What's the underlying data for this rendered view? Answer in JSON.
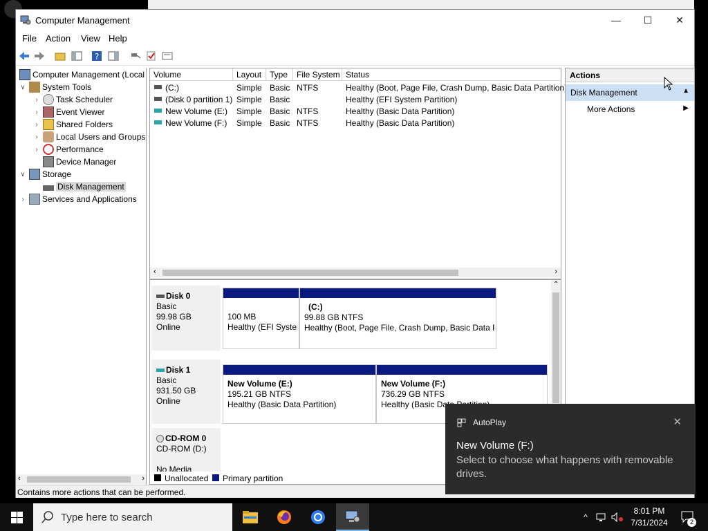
{
  "window": {
    "title": "Computer Management",
    "controls": {
      "minimize": "—",
      "maximize": "☐",
      "close": "✕"
    }
  },
  "menu": [
    "File",
    "Action",
    "View",
    "Help"
  ],
  "tree": {
    "root": "Computer Management (Local",
    "system_tools": "System Tools",
    "items": [
      "Task Scheduler",
      "Event Viewer",
      "Shared Folders",
      "Local Users and Groups",
      "Performance",
      "Device Manager"
    ],
    "storage": "Storage",
    "disk_management": "Disk Management",
    "services": "Services and Applications"
  },
  "volume_list": {
    "columns": [
      "Volume",
      "Layout",
      "Type",
      "File System",
      "Status"
    ],
    "rows": [
      {
        "volume": "(C:)",
        "layout": "Simple",
        "type": "Basic",
        "fs": "NTFS",
        "status": "Healthy (Boot, Page File, Crash Dump, Basic Data Partition)"
      },
      {
        "volume": "(Disk 0 partition 1)",
        "layout": "Simple",
        "type": "Basic",
        "fs": "",
        "status": "Healthy (EFI System Partition)"
      },
      {
        "volume": "New Volume (E:)",
        "layout": "Simple",
        "type": "Basic",
        "fs": "NTFS",
        "status": "Healthy (Basic Data Partition)"
      },
      {
        "volume": "New Volume (F:)",
        "layout": "Simple",
        "type": "Basic",
        "fs": "NTFS",
        "status": "Healthy (Basic Data Partition)"
      }
    ]
  },
  "disks": {
    "disk0": {
      "name": "Disk 0",
      "type": "Basic",
      "size": "99.98 GB",
      "state": "Online",
      "p1": {
        "size": "100 MB",
        "status": "Healthy (EFI Syster"
      },
      "p2": {
        "label": "(C:)",
        "size": "99.88 GB NTFS",
        "status": "Healthy (Boot, Page File, Crash Dump, Basic Data P"
      }
    },
    "disk1": {
      "name": "Disk 1",
      "type": "Basic",
      "size": "931.50 GB",
      "state": "Online",
      "p1": {
        "label": "New Volume  (E:)",
        "size": "195.21 GB NTFS",
        "status": "Healthy (Basic Data Partition)"
      },
      "p2": {
        "label": "New Volume  (F:)",
        "size": "736.29 GB NTFS",
        "status": "Healthy (Basic Data Partition)"
      }
    },
    "cdrom": {
      "name": "CD-ROM 0",
      "drive": "CD-ROM (D:)",
      "state": "No Media"
    }
  },
  "legend": {
    "unallocated": "Unallocated",
    "primary": "Primary partition"
  },
  "actions": {
    "header": "Actions",
    "section": "Disk Management",
    "more": "More Actions"
  },
  "statusbar": "Contains more actions that can be performed.",
  "toast": {
    "app": "AutoPlay",
    "title": "New Volume (F:)",
    "body": "Select to choose what happens with removable drives."
  },
  "taskbar": {
    "search_placeholder": "Type here to search",
    "time": "8:01 PM",
    "date": "7/31/2024",
    "notifications": "2"
  },
  "colors": {
    "partition_bar": "#0a1a80",
    "accent": "#0078d7",
    "selection": "#cce0f5"
  }
}
